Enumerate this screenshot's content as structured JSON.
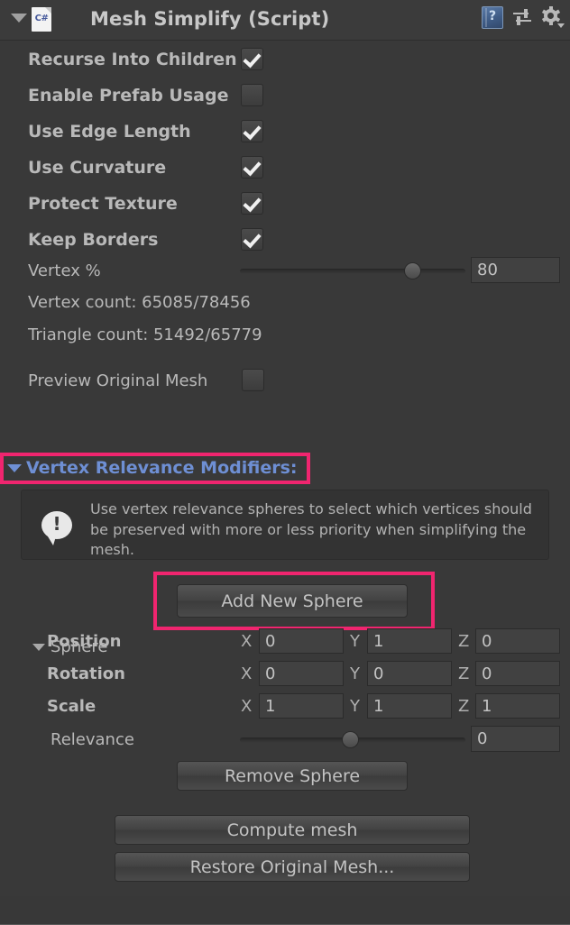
{
  "header": {
    "title": "Mesh Simplify (Script)",
    "script_badge": "C#",
    "foldout_expanded": true,
    "icons": [
      "help-book-icon",
      "preset-icon",
      "gear-icon"
    ]
  },
  "checkboxes": [
    {
      "label": "Recurse Into Children",
      "checked": true
    },
    {
      "label": "Enable Prefab Usage",
      "checked": false
    },
    {
      "label": "Use Edge Length",
      "checked": true
    },
    {
      "label": "Use Curvature",
      "checked": true
    },
    {
      "label": "Protect Texture",
      "checked": true
    },
    {
      "label": "Keep Borders",
      "checked": true
    }
  ],
  "vertex_percent": {
    "label": "Vertex %",
    "value": "80",
    "slider_fraction": 0.78
  },
  "counts": {
    "vertex": "Vertex count: 65085/78456",
    "triangle": "Triangle count: 51492/65779"
  },
  "preview": {
    "label": "Preview Original Mesh",
    "checked": false
  },
  "modifiers_section": {
    "label": "Vertex Relevance Modifiers:",
    "expanded": true,
    "highlighted": true,
    "info_text": "Use vertex relevance spheres to select which vertices should be preserved with more or less priority when simplifying the mesh.",
    "add_button": "Add New Sphere",
    "add_button_highlighted": true
  },
  "sphere": {
    "label": "Sphere",
    "expanded": true,
    "transform_rows": [
      {
        "name": "Position",
        "x": "0",
        "y": "1",
        "z": "0"
      },
      {
        "name": "Rotation",
        "x": "0",
        "y": "0",
        "z": "0"
      },
      {
        "name": "Scale",
        "x": "1",
        "y": "1",
        "z": "1"
      }
    ],
    "axis_labels": {
      "x": "X",
      "y": "Y",
      "z": "Z"
    },
    "relevance": {
      "label": "Relevance",
      "value": "0",
      "slider_fraction": 0.5
    },
    "remove_button": "Remove Sphere"
  },
  "actions": {
    "compute": "Compute mesh",
    "restore": "Restore Original Mesh..."
  },
  "colors": {
    "panel_bg": "#393939",
    "highlight": "#f0256f",
    "foldout_blue": "#6e8fd4",
    "text": "#b9b9b9"
  }
}
